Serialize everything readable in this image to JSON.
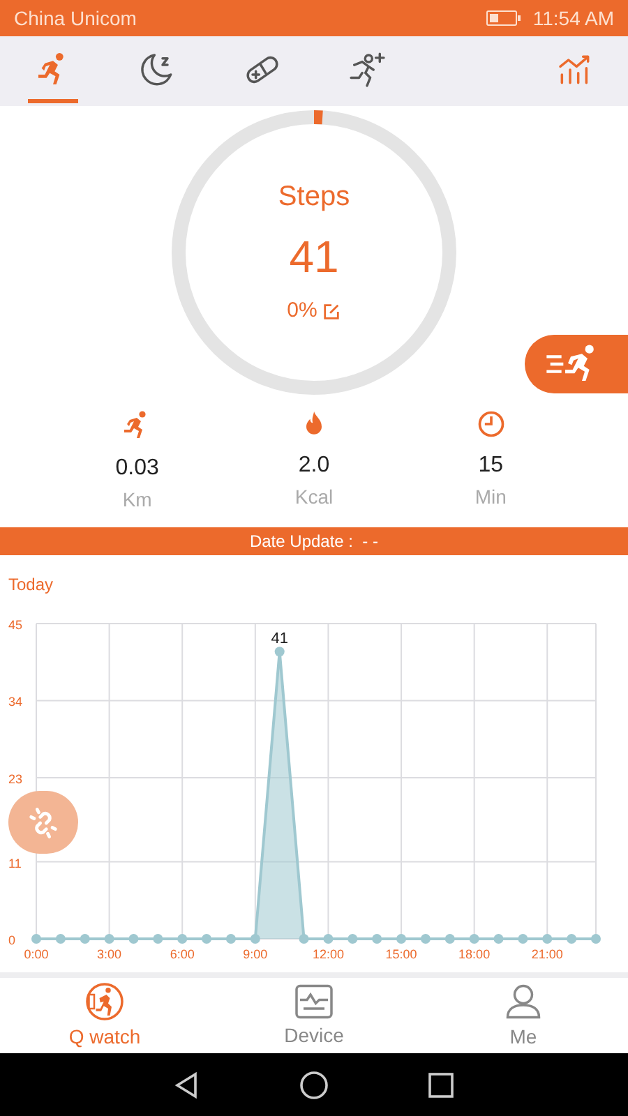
{
  "status_bar": {
    "carrier": "China Unicom",
    "time": "11:54 AM"
  },
  "tabs": [
    {
      "kind": "run",
      "selected": true
    },
    {
      "kind": "sleep",
      "selected": false
    },
    {
      "kind": "pill",
      "selected": false
    },
    {
      "kind": "run-plus",
      "selected": false
    },
    {
      "kind": "stats",
      "selected": false
    }
  ],
  "ring": {
    "title": "Steps",
    "value": "41",
    "percent": "0%",
    "level": 0.01
  },
  "stats": [
    {
      "kind": "run",
      "value": "0.03",
      "unit": "Km"
    },
    {
      "kind": "fire",
      "value": "2.0",
      "unit": "Kcal"
    },
    {
      "kind": "clock",
      "value": "15",
      "unit": "Min"
    }
  ],
  "date_update": "Date Update :  - -",
  "chart": {
    "label": "Today",
    "chart_data": {
      "type": "area",
      "x": [
        0,
        1,
        2,
        3,
        4,
        5,
        6,
        7,
        8,
        9,
        10,
        11,
        12,
        13,
        14,
        15,
        16,
        17,
        18,
        19,
        20,
        21,
        22,
        23
      ],
      "xlim": [
        0,
        23
      ],
      "grid": true,
      "series": [
        {
          "color": "#9fc8d0",
          "values": [
            0,
            0,
            0,
            0,
            0,
            0,
            0,
            0,
            0,
            0,
            41,
            0,
            0,
            0,
            0,
            0,
            0,
            0,
            0,
            0,
            0,
            0,
            0,
            0
          ]
        }
      ],
      "ylim": [
        0,
        45
      ],
      "yticks": [
        0,
        11,
        23,
        34,
        45
      ],
      "xticks": [
        {
          "value": 0,
          "label": "0:00"
        },
        {
          "value": 3,
          "label": "3:00"
        },
        {
          "value": 6,
          "label": "6:00"
        },
        {
          "value": 9,
          "label": "9:00"
        },
        {
          "value": 12,
          "label": "12:00"
        },
        {
          "value": 15,
          "label": "15:00"
        },
        {
          "value": 18,
          "label": "18:00"
        },
        {
          "value": 21,
          "label": "21:00"
        }
      ],
      "annotations": [
        {
          "x": 10,
          "y": 41,
          "text": "41"
        }
      ]
    }
  },
  "bottom_nav": [
    {
      "kind": "watch",
      "label": "Q watch",
      "selected": true
    },
    {
      "kind": "device",
      "label": "Device",
      "selected": false
    },
    {
      "kind": "me",
      "label": "Me",
      "selected": false
    }
  ]
}
